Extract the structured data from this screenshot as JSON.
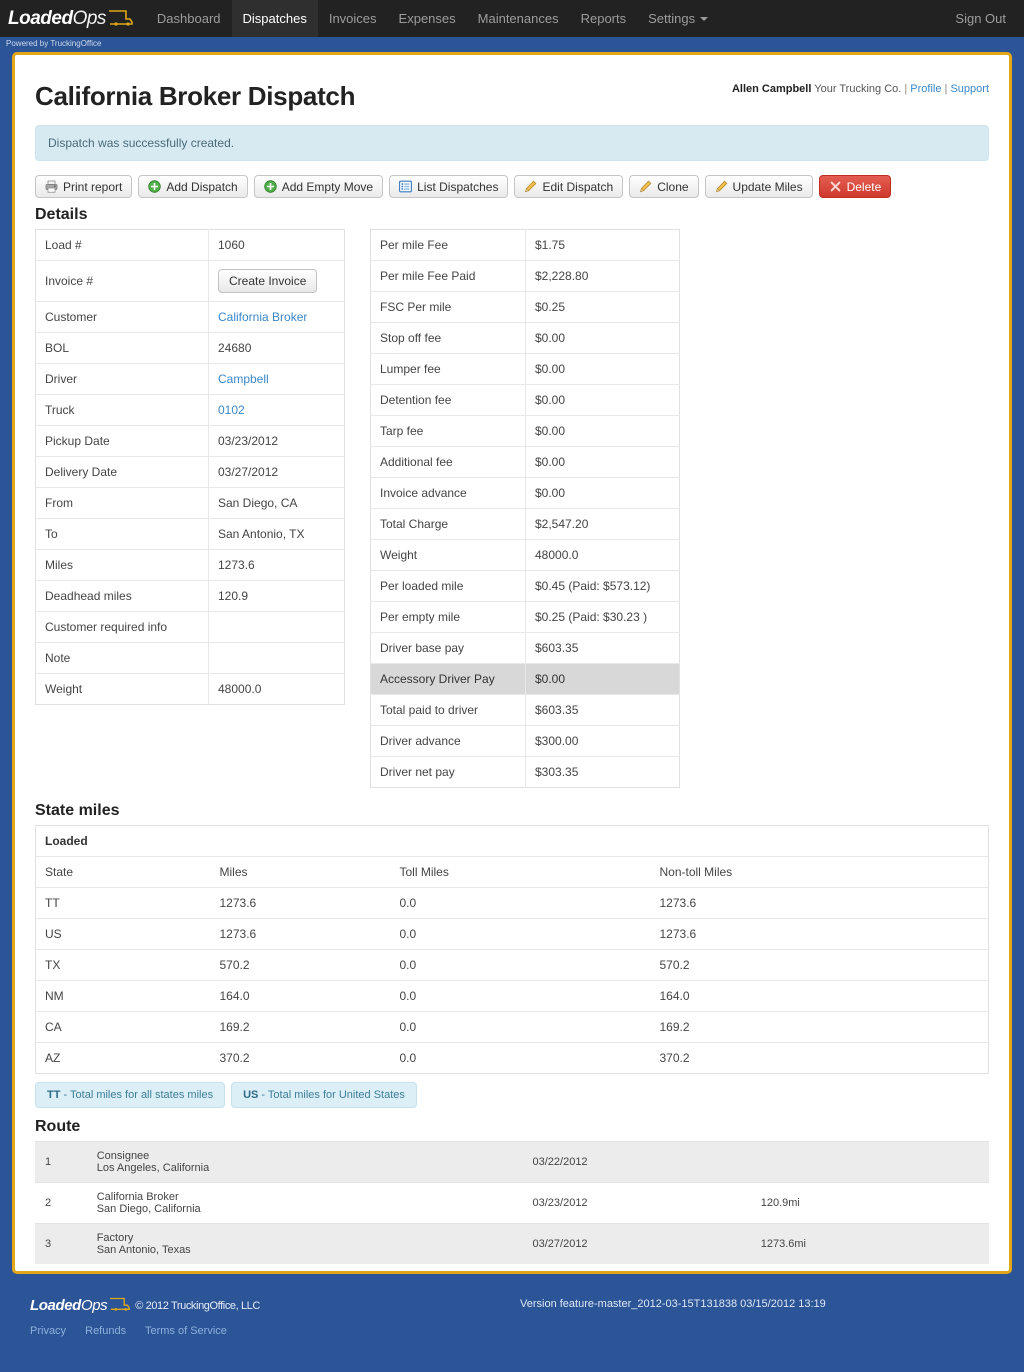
{
  "nav": {
    "logo_text": "Loaded",
    "logo_text2": "Ops",
    "items": [
      {
        "label": "Dashboard",
        "active": false
      },
      {
        "label": "Dispatches",
        "active": true
      },
      {
        "label": "Invoices",
        "active": false
      },
      {
        "label": "Expenses",
        "active": false
      },
      {
        "label": "Maintenances",
        "active": false
      },
      {
        "label": "Reports",
        "active": false
      },
      {
        "label": "Settings",
        "active": false,
        "dropdown": true
      }
    ],
    "sign_out": "Sign Out",
    "powered_by": "Powered by TruckingOffice"
  },
  "header": {
    "title": "California Broker Dispatch",
    "user_name": "Allen Campbell",
    "company": "Your Trucking Co.",
    "profile_link": "Profile",
    "support_link": "Support",
    "separator": "|"
  },
  "alert": {
    "message": "Dispatch was successfully created."
  },
  "toolbar": {
    "buttons": [
      {
        "label": "Print report",
        "icon": "printer-icon",
        "style": "default"
      },
      {
        "label": "Add Dispatch",
        "icon": "plus-circle-icon",
        "style": "default"
      },
      {
        "label": "Add Empty Move",
        "icon": "plus-circle-icon",
        "style": "default"
      },
      {
        "label": "List Dispatches",
        "icon": "list-icon",
        "style": "default"
      },
      {
        "label": "Edit Dispatch",
        "icon": "pencil-icon",
        "style": "default"
      },
      {
        "label": "Clone",
        "icon": "pencil-icon",
        "style": "default"
      },
      {
        "label": "Update Miles",
        "icon": "pencil-icon",
        "style": "default"
      },
      {
        "label": "Delete",
        "icon": "x-icon",
        "style": "danger"
      }
    ]
  },
  "details": {
    "heading": "Details",
    "create_invoice_label": "Create Invoice",
    "rows": [
      {
        "label": "Load #",
        "value": "1060",
        "type": "text"
      },
      {
        "label": "Invoice #",
        "value": "Create Invoice",
        "type": "button"
      },
      {
        "label": "Customer",
        "value": "California Broker",
        "type": "link"
      },
      {
        "label": "BOL",
        "value": "24680",
        "type": "text"
      },
      {
        "label": "Driver",
        "value": "Campbell",
        "type": "link"
      },
      {
        "label": "Truck",
        "value": "0102",
        "type": "link"
      },
      {
        "label": "Pickup Date",
        "value": "03/23/2012",
        "type": "text"
      },
      {
        "label": "Delivery Date",
        "value": "03/27/2012",
        "type": "text"
      },
      {
        "label": "From",
        "value": "San Diego, CA",
        "type": "text"
      },
      {
        "label": "To",
        "value": "San Antonio, TX",
        "type": "text"
      },
      {
        "label": "Miles",
        "value": "1273.6",
        "type": "text"
      },
      {
        "label": "Deadhead miles",
        "value": "120.9",
        "type": "text"
      },
      {
        "label": "Customer required info",
        "value": "",
        "type": "text"
      },
      {
        "label": "Note",
        "value": "",
        "type": "text"
      },
      {
        "label": "Weight",
        "value": "48000.0",
        "type": "text"
      }
    ]
  },
  "fees": {
    "rows": [
      {
        "label": "Per mile Fee",
        "value": "$1.75",
        "highlight": false
      },
      {
        "label": "Per mile Fee Paid",
        "value": "$2,228.80",
        "highlight": false
      },
      {
        "label": "FSC Per mile",
        "value": "$0.25",
        "highlight": false
      },
      {
        "label": "Stop off fee",
        "value": "$0.00",
        "highlight": false
      },
      {
        "label": "Lumper fee",
        "value": "$0.00",
        "highlight": false
      },
      {
        "label": "Detention fee",
        "value": "$0.00",
        "highlight": false
      },
      {
        "label": "Tarp fee",
        "value": "$0.00",
        "highlight": false
      },
      {
        "label": "Additional fee",
        "value": "$0.00",
        "highlight": false
      },
      {
        "label": "Invoice advance",
        "value": "$0.00",
        "highlight": false
      },
      {
        "label": "Total Charge",
        "value": "$2,547.20",
        "highlight": false
      },
      {
        "label": "Weight",
        "value": "48000.0",
        "highlight": false
      },
      {
        "label": "Per loaded mile",
        "value": "$0.45 (Paid: $573.12)",
        "highlight": false
      },
      {
        "label": "Per empty mile",
        "value": "$0.25 (Paid: $30.23 )",
        "highlight": false
      },
      {
        "label": "Driver base pay",
        "value": "$603.35",
        "highlight": false
      },
      {
        "label": "Accessory Driver Pay",
        "value": "$0.00",
        "highlight": true
      },
      {
        "label": "Total paid to driver",
        "value": "$603.35",
        "highlight": false
      },
      {
        "label": "Driver advance",
        "value": "$300.00",
        "highlight": false
      },
      {
        "label": "Driver net pay",
        "value": "$303.35",
        "highlight": false
      }
    ]
  },
  "state_miles": {
    "heading": "State miles",
    "group_label": "Loaded",
    "columns": [
      "State",
      "Miles",
      "Toll Miles",
      "Non-toll Miles"
    ],
    "rows": [
      {
        "state": "TT",
        "miles": "1273.6",
        "toll": "0.0",
        "nontoll": "1273.6"
      },
      {
        "state": "US",
        "miles": "1273.6",
        "toll": "0.0",
        "nontoll": "1273.6"
      },
      {
        "state": "TX",
        "miles": "570.2",
        "toll": "0.0",
        "nontoll": "570.2"
      },
      {
        "state": "NM",
        "miles": "164.0",
        "toll": "0.0",
        "nontoll": "164.0"
      },
      {
        "state": "CA",
        "miles": "169.2",
        "toll": "0.0",
        "nontoll": "169.2"
      },
      {
        "state": "AZ",
        "miles": "370.2",
        "toll": "0.0",
        "nontoll": "370.2"
      }
    ],
    "legend": [
      {
        "code": "TT",
        "text": " - Total miles for all states miles"
      },
      {
        "code": "US",
        "text": " - Total miles for United States"
      }
    ]
  },
  "route": {
    "heading": "Route",
    "rows": [
      {
        "num": "1",
        "name": "Consignee",
        "location": "Los Angeles, California",
        "date": "03/22/2012",
        "distance": ""
      },
      {
        "num": "2",
        "name": "California Broker",
        "location": "San Diego, California",
        "date": "03/23/2012",
        "distance": "120.9mi"
      },
      {
        "num": "3",
        "name": "Factory",
        "location": "San Antonio, Texas",
        "date": "03/27/2012",
        "distance": "1273.6mi"
      }
    ]
  },
  "footer": {
    "logo_text": "Loaded",
    "logo_text2": "Ops",
    "copyright": "© 2012 TruckingOffice, LLC",
    "version": "Version feature-master_2012-03-15T131838 03/15/2012 13:19",
    "links": [
      "Privacy",
      "Refunds",
      "Terms of Service"
    ]
  },
  "colors": {
    "brand_blue": "#2B5597",
    "frame_gold": "#E0A818",
    "link_blue": "#3a87c8",
    "danger_red": "#cf3a2d",
    "info_bg": "#D7EAF2",
    "nav_dark": "#222222"
  }
}
